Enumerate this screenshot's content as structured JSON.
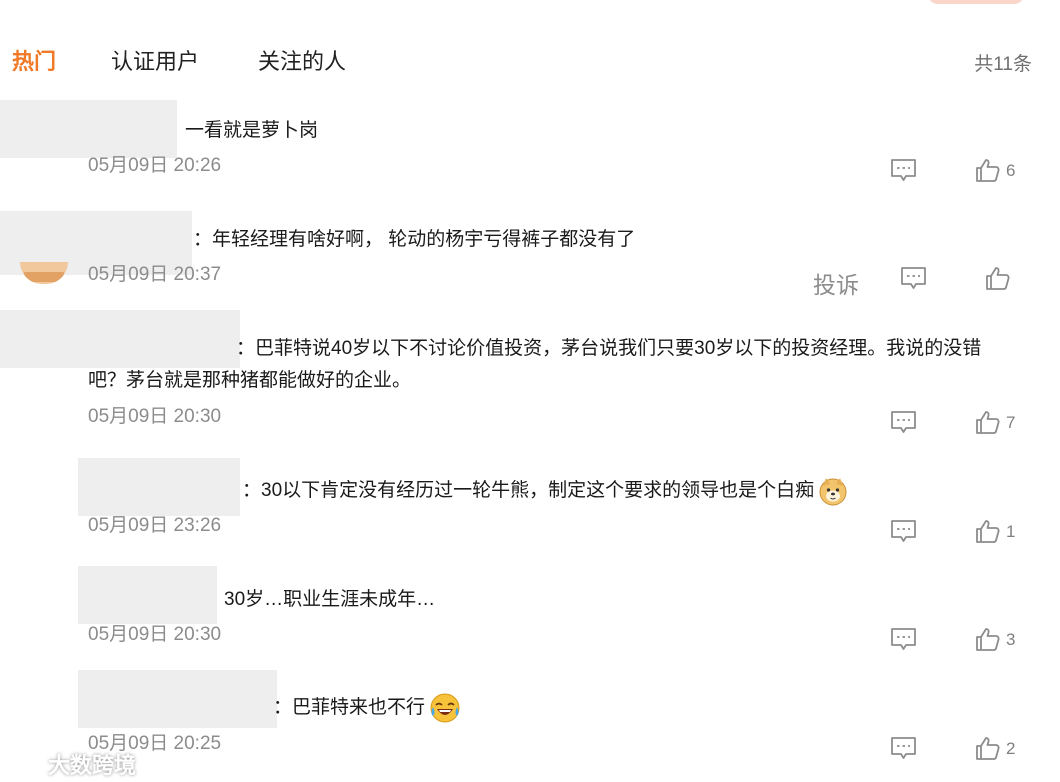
{
  "tabs": [
    {
      "label": "热门",
      "active": true
    },
    {
      "label": "认证用户",
      "active": false
    },
    {
      "label": "关注的人",
      "active": false
    }
  ],
  "total": "共11条",
  "report_label": "投诉",
  "comments": [
    {
      "text": "一看就是萝卜岗",
      "time": "05月09日 20:26",
      "likes": "6"
    },
    {
      "text": "：年轻经理有啥好啊，  轮动的杨宇亏得裤子都没有了",
      "time": "05月09日 20:37",
      "likes": ""
    },
    {
      "text_line1": "：巴菲特说40岁以下不讨论价值投资，茅台说我们只要30岁以下的投资经理。我说的没错",
      "text_line2": "吧？茅台就是那种猪都能做好的企业。",
      "time": "05月09日 20:30",
      "likes": "7"
    },
    {
      "text": "：30以下肯定没有经历过一轮牛熊，制定这个要求的领导也是个白痴",
      "emoji": "doge-emoji",
      "time": "05月09日 23:26",
      "likes": "1"
    },
    {
      "text": "30岁…职业生涯未成年…",
      "time": "05月09日 20:30",
      "likes": "3"
    },
    {
      "text": "：巴菲特来也不行",
      "emoji": "laughing-crying-emoji",
      "time": "05月09日 20:25",
      "likes": "2"
    }
  ],
  "icons": {
    "comment": "comment-icon",
    "like": "thumbs-up-icon"
  },
  "colors": {
    "accent": "#f07a28",
    "muted": "#8c8c8c"
  },
  "watermark": "大数跨境"
}
